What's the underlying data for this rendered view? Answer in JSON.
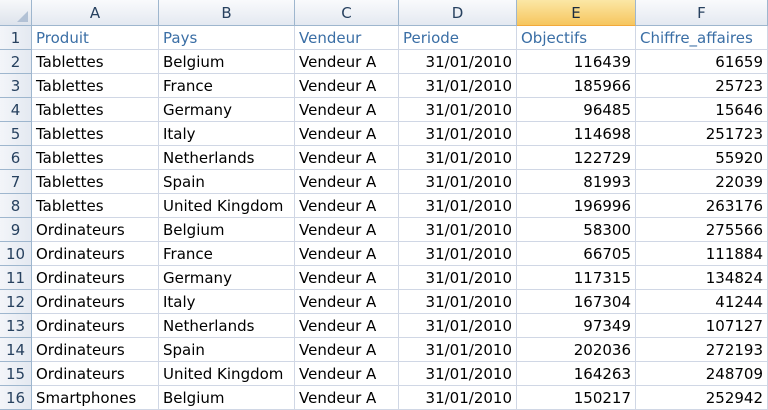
{
  "columns": [
    "A",
    "B",
    "C",
    "D",
    "E",
    "F"
  ],
  "selected_column": "E",
  "header_row": {
    "row_number": "1",
    "cells": [
      "Produit",
      "Pays",
      "Vendeur",
      "Periode",
      "Objectifs",
      "Chiffre_affaires"
    ]
  },
  "rows": [
    {
      "n": "2",
      "cells": [
        "Tablettes",
        "Belgium",
        "Vendeur A",
        "31/01/2010",
        "116439",
        "61659"
      ]
    },
    {
      "n": "3",
      "cells": [
        "Tablettes",
        "France",
        "Vendeur A",
        "31/01/2010",
        "185966",
        "25723"
      ]
    },
    {
      "n": "4",
      "cells": [
        "Tablettes",
        "Germany",
        "Vendeur A",
        "31/01/2010",
        "96485",
        "15646"
      ]
    },
    {
      "n": "5",
      "cells": [
        "Tablettes",
        "Italy",
        "Vendeur A",
        "31/01/2010",
        "114698",
        "251723"
      ]
    },
    {
      "n": "6",
      "cells": [
        "Tablettes",
        "Netherlands",
        "Vendeur A",
        "31/01/2010",
        "122729",
        "55920"
      ]
    },
    {
      "n": "7",
      "cells": [
        "Tablettes",
        "Spain",
        "Vendeur A",
        "31/01/2010",
        "81993",
        "22039"
      ]
    },
    {
      "n": "8",
      "cells": [
        "Tablettes",
        "United Kingdom",
        "Vendeur A",
        "31/01/2010",
        "196996",
        "263176"
      ]
    },
    {
      "n": "9",
      "cells": [
        "Ordinateurs",
        "Belgium",
        "Vendeur A",
        "31/01/2010",
        "58300",
        "275566"
      ]
    },
    {
      "n": "10",
      "cells": [
        "Ordinateurs",
        "France",
        "Vendeur A",
        "31/01/2010",
        "66705",
        "111884"
      ]
    },
    {
      "n": "11",
      "cells": [
        "Ordinateurs",
        "Germany",
        "Vendeur A",
        "31/01/2010",
        "117315",
        "134824"
      ]
    },
    {
      "n": "12",
      "cells": [
        "Ordinateurs",
        "Italy",
        "Vendeur A",
        "31/01/2010",
        "167304",
        "41244"
      ]
    },
    {
      "n": "13",
      "cells": [
        "Ordinateurs",
        "Netherlands",
        "Vendeur A",
        "31/01/2010",
        "97349",
        "107127"
      ]
    },
    {
      "n": "14",
      "cells": [
        "Ordinateurs",
        "Spain",
        "Vendeur A",
        "31/01/2010",
        "202036",
        "272193"
      ]
    },
    {
      "n": "15",
      "cells": [
        "Ordinateurs",
        "United Kingdom",
        "Vendeur A",
        "31/01/2010",
        "164263",
        "248709"
      ]
    },
    {
      "n": "16",
      "cells": [
        "Smartphones",
        "Belgium",
        "Vendeur A",
        "31/01/2010",
        "150217",
        "252942"
      ]
    }
  ],
  "colors": {
    "header_text": "#3a6ea5",
    "selected_column_fill": "#f6c65f",
    "gridline": "#d0d7e5"
  }
}
